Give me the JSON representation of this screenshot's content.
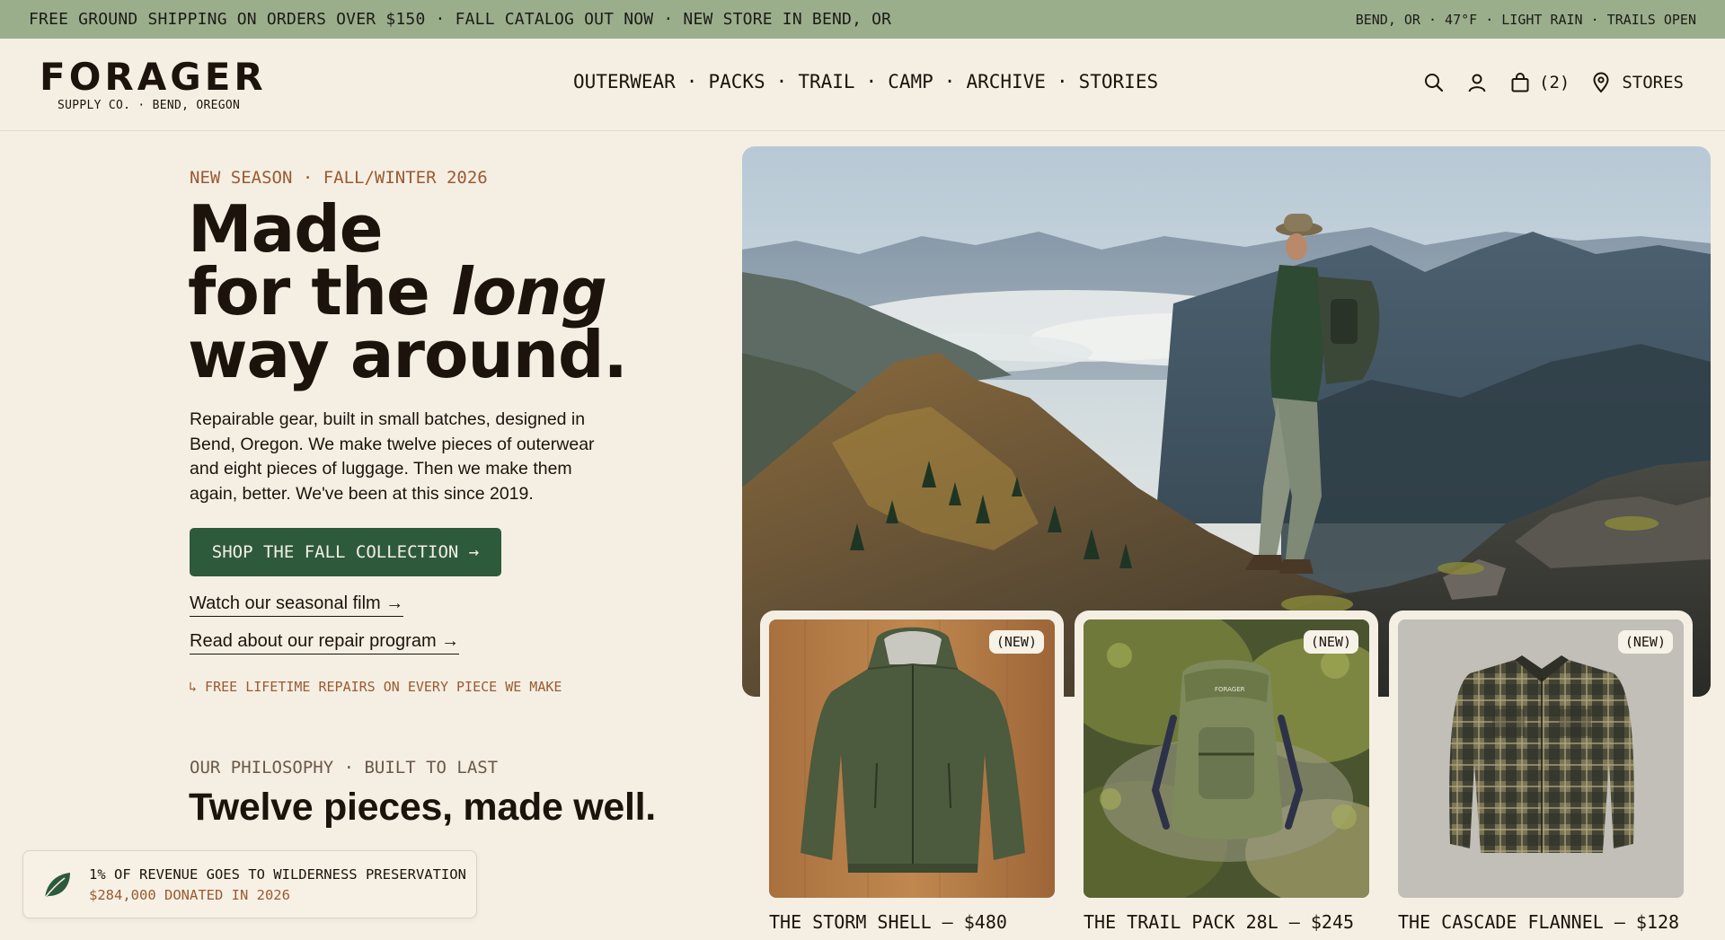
{
  "announcement": {
    "left_text": "FREE GROUND SHIPPING ON ORDERS OVER $150 · FALL CATALOG OUT NOW · NEW STORE IN BEND, OR",
    "right_text": "BEND, OR · 47°F · LIGHT RAIN · TRAILS OPEN"
  },
  "brand": {
    "name": "FORAGER",
    "tagline": "SUPPLY CO. · BEND, OREGON"
  },
  "nav": {
    "items": [
      "OUTERWEAR",
      "PACKS",
      "TRAIL",
      "CAMP",
      "ARCHIVE",
      "STORIES"
    ],
    "separator": "·"
  },
  "header_actions": {
    "search_icon": "search-icon",
    "account_icon": "user-icon",
    "cart_icon": "bag-icon",
    "cart_count": "(2)",
    "stores_icon": "map-pin-icon",
    "stores_label": "STORES"
  },
  "hero": {
    "eyebrow": "NEW SEASON · FALL/WINTER 2026",
    "headline_line1": "Made",
    "headline_line2_prefix": "for the ",
    "headline_line2_italic": "long",
    "headline_line3": "way around.",
    "body": "Repairable gear, built in small batches, designed in Bend, Oregon. We make twelve pieces of outerwear and eight pieces of luggage. Then we make them again, better. We've been at this since 2019.",
    "cta_label": "SHOP THE FALL COLLECTION →",
    "link1": "Watch our seasonal film →",
    "link2": "Read about our repair program →",
    "repairs_note": "↳ FREE LIFETIME REPAIRS ON EVERY PIECE WE MAKE"
  },
  "philosophy": {
    "eyebrow": "OUR PHILOSOPHY · BUILT TO LAST",
    "heading": "Twelve pieces, made well."
  },
  "products": [
    {
      "badge": "(NEW)",
      "label": "THE STORM SHELL — $480"
    },
    {
      "badge": "(NEW)",
      "label": "THE TRAIL PACK 28L — $245"
    },
    {
      "badge": "(NEW)",
      "label": "THE CASCADE FLANNEL — $128"
    }
  ],
  "donation": {
    "icon": "leaf-icon",
    "line1": "1% OF REVENUE GOES TO WILDERNESS PRESERVATION",
    "line2": "$284,000 DONATED IN 2026"
  },
  "pack_logo_text": "FORAGER",
  "colors": {
    "announcement_bg": "#9aae8c",
    "page_bg": "#f5efe3",
    "accent_green": "#2e5a3c",
    "accent_rust": "#9a5a32",
    "text": "#1c130c"
  }
}
